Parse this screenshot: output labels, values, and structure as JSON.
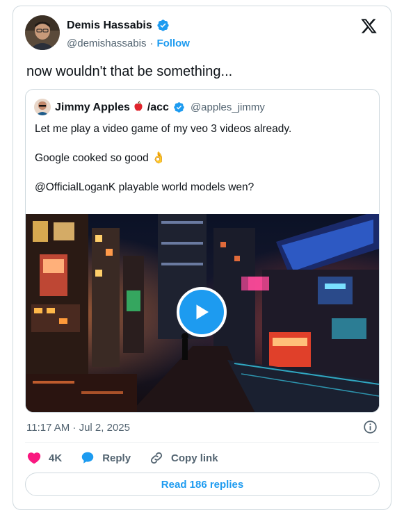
{
  "author": {
    "name": "Demis Hassabis",
    "handle": "@demishassabis",
    "separator": "·",
    "follow_label": "Follow",
    "avatar_icon": "avatar-photo"
  },
  "brand_icon": "x-logo-icon",
  "tweet": {
    "text": "now wouldn't that be something..."
  },
  "quote": {
    "name": "Jimmy Apples",
    "name_suffix": "/acc",
    "handle": "@apples_jimmy",
    "lines": [
      "Let me play a video game of my veo 3 videos already.",
      "Google cooked so good",
      "@OfficialLoganK  playable world models wen?"
    ],
    "emoji_ok": "👌",
    "video_icon": "play-icon"
  },
  "meta": {
    "timestamp": "11:17 AM · Jul 2, 2025"
  },
  "actions": {
    "likes_count": "4K",
    "reply_label": "Reply",
    "copy_link_label": "Copy link"
  },
  "footer": {
    "read_replies_label": "Read 186 replies"
  },
  "colors": {
    "accent": "#1d9bf0",
    "like": "#f91880",
    "text": "#0f1419",
    "muted": "#536471",
    "border": "#cfd9de"
  }
}
